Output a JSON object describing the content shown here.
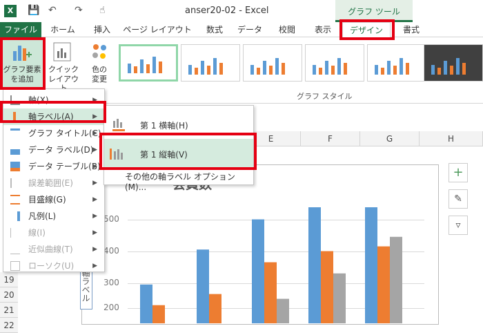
{
  "window": {
    "title": "anser20-02 - Excel",
    "tool_context": "グラフ ツール",
    "app_icon": "X"
  },
  "qat": {
    "save_icon": "save-icon",
    "undo_icon": "undo-icon",
    "redo_icon": "redo-icon",
    "touch_icon": "touch-mode-icon"
  },
  "tabs": {
    "file": "ファイル",
    "home": "ホーム",
    "insert": "挿入",
    "layout": "ページ レイアウト",
    "formulas": "数式",
    "data": "データ",
    "review": "校閲",
    "view": "表示",
    "design": "デザイン",
    "format": "書式"
  },
  "ribbon": {
    "add_element": [
      "グラフ要素",
      "を追加"
    ],
    "quick_layout": [
      "クイック",
      "レイアウト"
    ],
    "change_colors": [
      "色の",
      "変更"
    ],
    "styles_group": "グラフ スタイル"
  },
  "columns": [
    "E",
    "F",
    "G",
    "H"
  ],
  "rows": [
    "19",
    "20",
    "21",
    "22"
  ],
  "menu": {
    "items": [
      {
        "label": "軸(X)",
        "arrow": true,
        "disabled": false
      },
      {
        "label": "軸ラベル(A)",
        "arrow": true,
        "disabled": false,
        "highlight": true
      },
      {
        "label": "グラフ タイトル(C)",
        "arrow": true,
        "disabled": false
      },
      {
        "label": "データ ラベル(D)",
        "arrow": true,
        "disabled": false
      },
      {
        "label": "データ テーブル(B)",
        "arrow": true,
        "disabled": false
      },
      {
        "label": "誤差範囲(E)",
        "arrow": true,
        "disabled": true
      },
      {
        "label": "目盛線(G)",
        "arrow": true,
        "disabled": false
      },
      {
        "label": "凡例(L)",
        "arrow": true,
        "disabled": false
      },
      {
        "label": "線(I)",
        "arrow": true,
        "disabled": true
      },
      {
        "label": "近似曲線(T)",
        "arrow": true,
        "disabled": true
      },
      {
        "label": "ローソク(U)",
        "arrow": true,
        "disabled": true
      }
    ]
  },
  "submenu": {
    "horizontal": "第 1 横軸(H)",
    "vertical": "第 1 縦軸(V)",
    "more": "その他の軸ラベル オプション(M)..."
  },
  "chart": {
    "title": "会員数",
    "ticks": [
      "500",
      "400",
      "300",
      "200"
    ],
    "axis_label": "軸ラベル",
    "colors": {
      "blue": "#5b9bd5",
      "orange": "#ed7d31",
      "gray": "#a5a5a5"
    }
  },
  "chart_data": {
    "type": "bar",
    "ylim": [
      200,
      500
    ],
    "series": [
      {
        "values": [
          270,
          380,
          475,
          535,
          545
        ]
      },
      {
        "values": [
          205,
          240,
          340,
          375,
          390
        ]
      },
      {
        "values": [
          null,
          null,
          225,
          305,
          420
        ]
      }
    ]
  }
}
